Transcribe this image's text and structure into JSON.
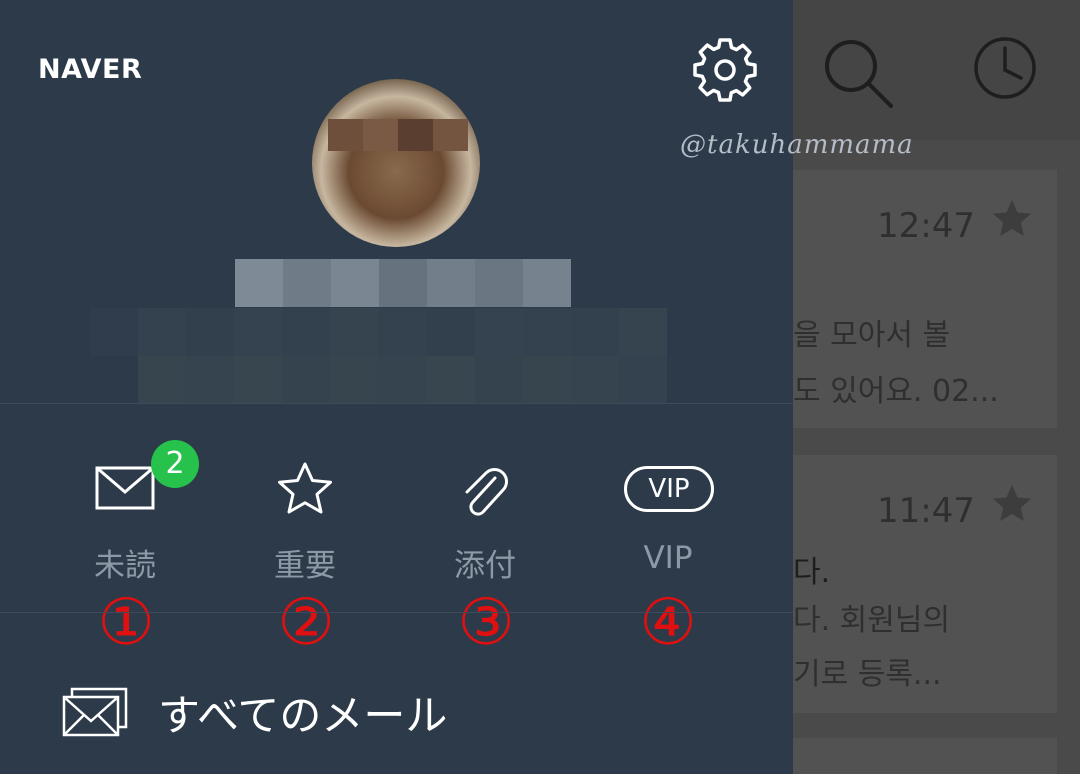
{
  "brand": "NAVER",
  "watermark": "@takuhammama",
  "quick_filters": [
    {
      "label": "未読",
      "icon": "envelope-icon",
      "badge": "2"
    },
    {
      "label": "重要",
      "icon": "star-icon"
    },
    {
      "label": "添付",
      "icon": "paperclip-icon"
    },
    {
      "label": "VIP",
      "icon": "vip-icon",
      "icon_text": "VIP"
    }
  ],
  "annotations": [
    "①",
    "②",
    "③",
    "④"
  ],
  "all_mail": {
    "label": "すべてのメール",
    "icon": "all-mail-icon"
  },
  "background_list": {
    "items": [
      {
        "time": "12:47",
        "lines": [
          "을 모아서 볼",
          "도 있어요. 02..."
        ]
      },
      {
        "time": "11:47",
        "lines": [
          "다.",
          "다. 회원님의",
          "기로 등록..."
        ]
      }
    ]
  },
  "colors": {
    "drawer_bg": "#2c3a49",
    "badge": "#26c24b",
    "annotation": "#e01010",
    "label": "#8d99a6"
  }
}
